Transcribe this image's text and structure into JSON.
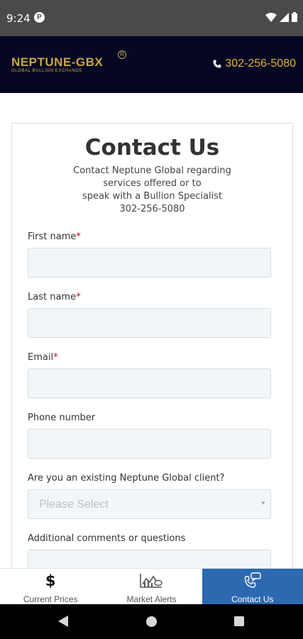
{
  "status_bar": {
    "time": "9:24",
    "app_icon_letter": "P"
  },
  "header": {
    "logo_text": "NEPTUNE-GBX",
    "logo_tagline": "GLOBAL BULLION EXCHANGE",
    "logo_registered": "R",
    "phone": "302-256-5080",
    "accent_color": "#e2b23c",
    "background_color": "#060823"
  },
  "contact": {
    "title": "Contact Us",
    "subtitle_lines": [
      "Contact Neptune Global regarding",
      "services offered or to",
      "speak with a Bullion Specialist",
      "302-256-5080"
    ]
  },
  "form": {
    "required_marker": "*",
    "fields": [
      {
        "label": "First name",
        "value": "",
        "required": true
      },
      {
        "label": "Last name",
        "value": "",
        "required": true
      },
      {
        "label": "Email",
        "value": "",
        "required": true
      },
      {
        "label": "Phone number",
        "value": "",
        "required": false
      }
    ],
    "client_question": {
      "label": "Are you an existing Neptune Global client?",
      "selected": "Please Select"
    },
    "comments": {
      "label": "Additional comments or questions",
      "value": ""
    }
  },
  "bottom_nav": {
    "items": [
      {
        "label": "Current Prices",
        "icon": "dollar-icon"
      },
      {
        "label": "Market Alerts",
        "icon": "chart-alert-icon"
      },
      {
        "label": "Contact Us",
        "icon": "phone-chat-icon",
        "active": true
      }
    ],
    "active_color": "#2d69b0"
  }
}
